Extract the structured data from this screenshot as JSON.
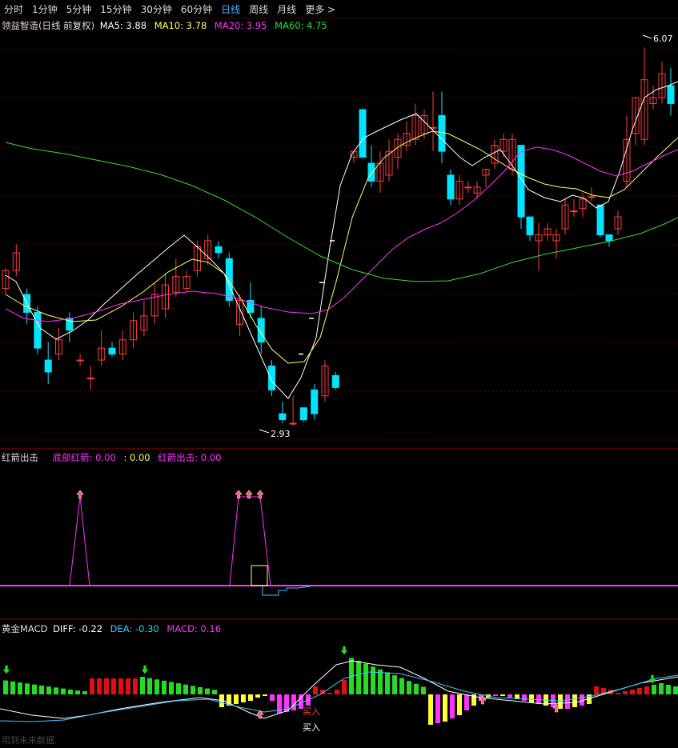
{
  "toolbar": {
    "periods": [
      "分时",
      "1分钟",
      "5分钟",
      "15分钟",
      "30分钟",
      "60分钟",
      "日线",
      "周线",
      "月线",
      "更多 >"
    ],
    "active": "日线"
  },
  "colors": {
    "up": "#ff3c3c",
    "down": "#00e5ff",
    "ma5": "#ffffff",
    "ma10": "#ffff66",
    "ma20": "#ff33ff",
    "ma60": "#33dd33",
    "grid": "#5a0000",
    "macd_pos": "#e01010",
    "macd_neg": "#22dd22",
    "macd_y": "#ffff33",
    "macd_m": "#ff33ff"
  },
  "price_pane": {
    "stock": "领益智造(日线 前复权)",
    "ma5": "MA5: 3.88",
    "ma10": "MA10: 3.78",
    "ma20": "MA20: 3.95",
    "ma60": "MA60: 4.75",
    "high_label": "6.07",
    "low_label": "2.93",
    "ylim": [
      2.8,
      6.2
    ]
  },
  "signal_pane": {
    "name": "红箭出击",
    "p1": "底部红箭: 0.00",
    "p2": ": 0.00",
    "p3": "红箭出击: 0.00"
  },
  "macd_pane": {
    "name": "黄金MACD",
    "diff": "DIFF: -0.22",
    "dea": "DEA: -0.30",
    "macd": "MACD: 0.16",
    "buy1": "买入",
    "buy2": "买入"
  },
  "footer": "用到未来数据",
  "chart_data": {
    "type": "candlestick",
    "candles": [
      [
        4.05,
        4.2,
        4.22,
        4.0
      ],
      [
        4.2,
        4.35,
        4.42,
        4.15
      ],
      [
        4.0,
        3.85,
        4.05,
        3.75
      ],
      [
        3.85,
        3.55,
        3.9,
        3.5
      ],
      [
        3.45,
        3.35,
        3.6,
        3.25
      ],
      [
        3.5,
        3.62,
        3.72,
        3.45
      ],
      [
        3.8,
        3.7,
        3.85,
        3.6
      ],
      [
        3.45,
        3.45,
        3.5,
        3.4
      ],
      [
        3.3,
        3.3,
        3.4,
        3.2
      ],
      [
        3.45,
        3.55,
        3.7,
        3.4
      ],
      [
        3.55,
        3.5,
        3.6,
        3.48
      ],
      [
        3.5,
        3.62,
        3.7,
        3.45
      ],
      [
        3.62,
        3.78,
        3.85,
        3.55
      ],
      [
        3.7,
        3.82,
        3.95,
        3.65
      ],
      [
        3.82,
        4.0,
        4.1,
        3.75
      ],
      [
        3.88,
        4.08,
        4.18,
        3.8
      ],
      [
        4.02,
        4.15,
        4.3,
        3.98
      ],
      [
        4.05,
        4.15,
        4.2,
        4.02
      ],
      [
        4.2,
        4.4,
        4.45,
        4.15
      ],
      [
        4.3,
        4.45,
        4.5,
        4.25
      ],
      [
        4.4,
        4.35,
        4.45,
        4.3
      ],
      [
        4.3,
        3.95,
        4.35,
        3.9
      ],
      [
        3.75,
        3.95,
        4.0,
        3.65
      ],
      [
        3.95,
        3.85,
        4.1,
        3.8
      ],
      [
        3.8,
        3.6,
        3.9,
        3.5
      ],
      [
        3.4,
        3.2,
        3.45,
        3.15
      ],
      [
        3.0,
        2.95,
        3.1,
        2.92
      ],
      [
        2.92,
        2.92,
        3.15,
        2.9
      ],
      [
        3.05,
        2.95,
        3.05,
        2.93
      ],
      [
        3.2,
        3.0,
        3.25,
        2.95
      ],
      [
        3.15,
        3.4,
        3.45,
        3.1
      ],
      [
        3.32,
        3.22,
        3.35,
        3.2
      ]
    ],
    "gap_dashes": [
      3.5,
      3.8,
      4.1,
      4.45
    ],
    "candles2": [
      [
        5.15,
        5.2,
        5.2,
        5.1
      ],
      [
        5.55,
        5.15,
        5.55,
        5.15
      ],
      [
        5.1,
        4.95,
        5.25,
        4.9
      ],
      [
        4.95,
        5.1,
        5.2,
        4.85
      ],
      [
        5.0,
        5.2,
        5.3,
        4.95
      ],
      [
        5.15,
        5.3,
        5.35,
        5.05
      ],
      [
        5.25,
        5.35,
        5.45,
        5.2
      ],
      [
        5.3,
        5.5,
        5.6,
        5.25
      ],
      [
        5.35,
        5.5,
        5.55,
        5.3
      ],
      [
        5.4,
        5.4,
        5.7,
        5.2
      ],
      [
        5.5,
        5.2,
        5.7,
        5.1
      ],
      [
        5.0,
        4.8,
        5.05,
        4.75
      ],
      [
        4.8,
        4.95,
        5.0,
        4.75
      ],
      [
        4.9,
        4.9,
        4.95,
        4.85
      ],
      [
        4.85,
        4.9,
        4.95,
        4.8
      ],
      [
        5.0,
        5.05,
        5.05,
        4.9
      ],
      [
        5.1,
        5.25,
        5.3,
        5.05
      ],
      [
        5.2,
        5.3,
        5.35,
        5.15
      ],
      [
        5.05,
        5.3,
        5.35,
        5.0
      ],
      [
        5.25,
        4.65,
        5.25,
        4.55
      ],
      [
        4.65,
        4.5,
        4.65,
        4.45
      ],
      [
        4.45,
        4.5,
        4.6,
        4.2
      ],
      [
        4.5,
        4.55,
        4.6,
        4.45
      ],
      [
        4.45,
        4.5,
        4.55,
        4.3
      ],
      [
        4.55,
        4.75,
        4.8,
        4.5
      ],
      [
        4.7,
        4.7,
        4.8,
        4.65
      ],
      [
        4.72,
        4.8,
        4.85,
        4.65
      ],
      [
        4.82,
        4.82,
        4.9,
        4.78
      ],
      [
        4.75,
        4.5,
        4.75,
        4.48
      ],
      [
        4.5,
        4.45,
        4.5,
        4.4
      ],
      [
        4.55,
        4.65,
        4.7,
        4.5
      ],
      [
        4.95,
        5.3,
        5.5,
        4.9
      ],
      [
        5.35,
        5.65,
        5.65,
        5.25
      ],
      [
        5.3,
        5.8,
        6.07,
        5.25
      ],
      [
        5.6,
        5.65,
        5.75,
        5.55
      ],
      [
        5.65,
        5.85,
        5.95,
        5.6
      ],
      [
        5.75,
        5.6,
        5.9,
        5.5
      ]
    ]
  }
}
